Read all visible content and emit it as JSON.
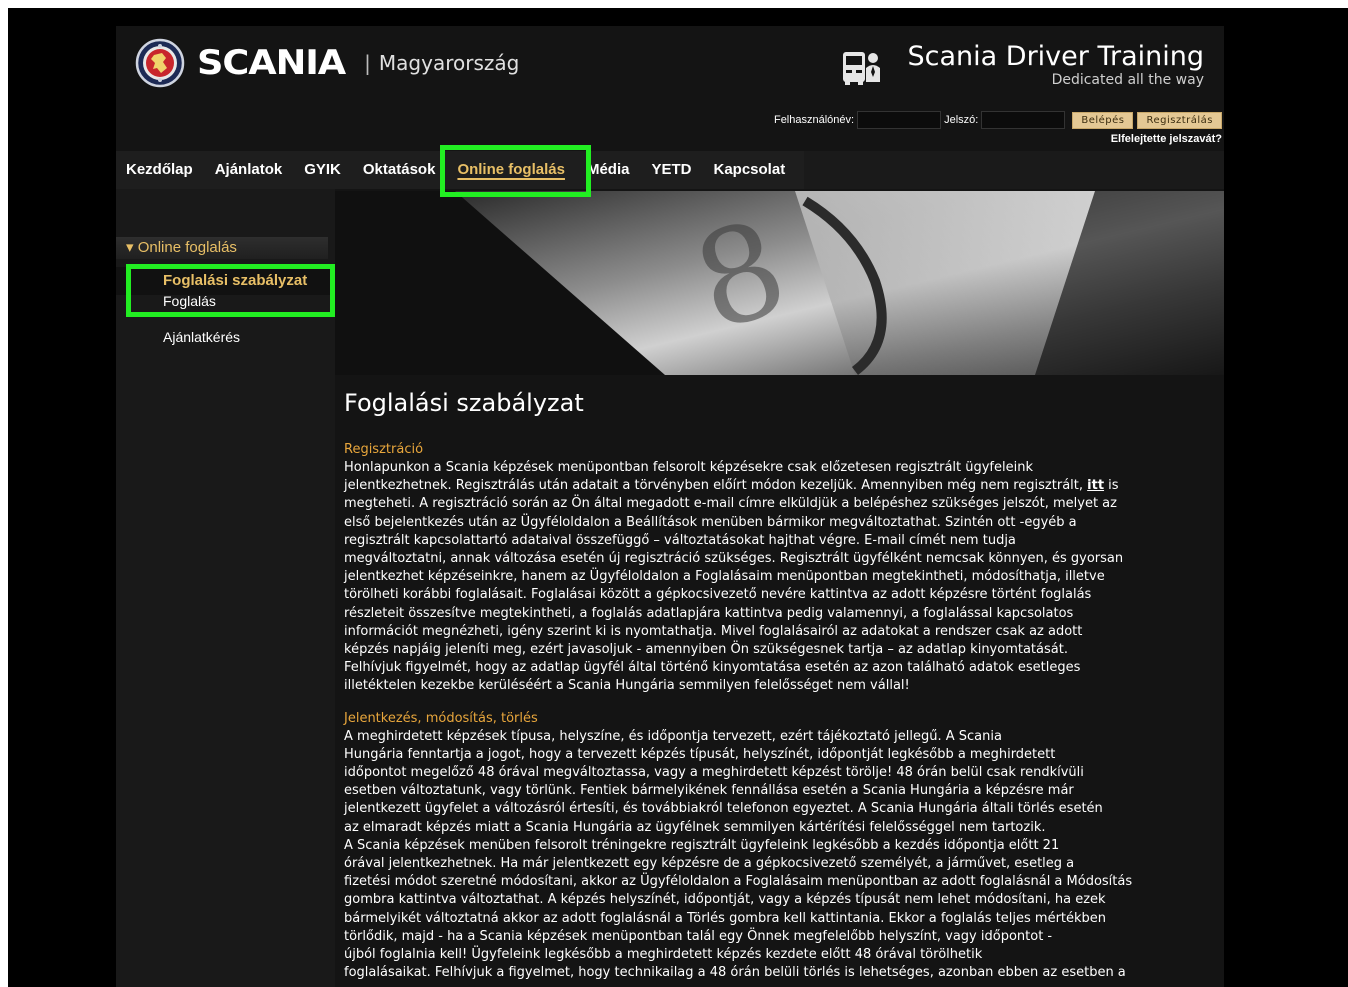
{
  "header": {
    "brand": "SCANIA",
    "country_sep": "|",
    "country": "Magyarország",
    "dt_title": "Scania Driver Training",
    "dt_subtitle": "Dedicated all the way"
  },
  "login": {
    "username_label": "Felhasználónév:",
    "password_label": "Jelszó:",
    "login_button": "Belépés",
    "register_button": "Regisztrálás",
    "forgot_link": "Elfelejtette jelszavát?"
  },
  "nav": {
    "items": [
      "Kezdőlap",
      "Ajánlatok",
      "GYIK",
      "Oktatások",
      "Online foglalás",
      "Média",
      "YETD",
      "Kapcsolat"
    ],
    "active_index": 4
  },
  "sidebar": {
    "heading": "Online foglalás",
    "items": [
      "Foglalási szabályzat",
      "Foglalás",
      "Ajánlatkérés"
    ],
    "active_index": 0
  },
  "content": {
    "title": "Foglalási szabályzat",
    "sections": [
      {
        "heading": "Regisztráció",
        "lines": [
          "Honlapunkon a Scania képzések menüpontban felsorolt képzésekre csak előzetesen regisztrált ügyfeleink",
          "jelentkezhetnek. Regisztrálás után adatait a törvényben előírt módon kezeljük. Amennyiben még nem regisztrált,",
          "megteheti. A regisztráció során az Ön által megadott e-mail címre elküldjük a belépéshez szükséges jelszót, melyet az",
          "első bejelentkezés után az Ügyféloldalon a Beállítások menüben bármikor megváltoztathat. Szintén ott -egyéb a",
          "regisztrált kapcsolattartó adataival összefüggő – változtatásokat hajthat végre. E-mail címét nem tudja",
          "megváltoztatni, annak változása esetén új regisztráció szükséges. Regisztrált ügyfélként nemcsak könnyen, és gyorsan",
          "jelentkezhet képzéseinkre, hanem az Ügyféloldalon a Foglalásaim menüpontban megtekintheti, módosíthatja, illetve",
          "törölheti korábbi foglalásait. Foglalásai között a gépkocsivezető nevére kattintva az adott képzésre történt foglalás",
          "részleteit összesítve megtekintheti, a foglalás adatlapjára kattintva pedig valamennyi, a foglalással kapcsolatos",
          "információt megnézheti, igény szerint ki is nyomtathatja. Mivel foglalásairól az adatokat a rendszer csak az adott",
          "képzés napjáig jeleníti meg, ezért javasoljuk - amennyiben Ön szükségesnek tartja – az adatlap kinyomtatását.",
          "Felhívjuk figyelmét, hogy az adatlap ügyfél által történő kinyomtatása esetén az azon található adatok esetleges",
          "illetéktelen kezekbe kerüléséért a Scania Hungária semmilyen felelősséget nem vállal!"
        ],
        "link_text": "itt",
        "link_suffix": " is"
      },
      {
        "heading": "Jelentkezés, módosítás, törlés",
        "lines": [
          "A meghirdetett képzések típusa, helyszíne, és időpontja tervezett, ezért tájékoztató jellegű. A Scania",
          "Hungária fenntartja a jogot, hogy a tervezett képzés típusát, helyszínét, időpontját legkésőbb a meghirdetett",
          "időpontot megelőző 48 órával megváltoztassa, vagy a meghirdetett képzést törölje! 48 órán belül csak rendkívüli",
          "esetben változtatunk, vagy törlünk. Fentiek bármelyikének fennállása esetén a Scania Hungária a képzésre már",
          "jelentkezett ügyfelet a változásról értesíti, és továbbiakról telefonon egyeztet. A Scania Hungária általi törlés esetén",
          "az elmaradt képzés miatt a Scania Hungária az ügyfélnek semmilyen kártérítési felelősséggel nem tartozik.",
          "A Scania képzések menüben felsorolt tréningekre regisztrált ügyfeleink legkésőbb a kezdés időpontja előtt 21",
          "órával jelentkezhetnek. Ha már jelentkezett egy képzésre de a gépkocsivezető személyét, a járművet, esetleg a",
          "fizetési módot szeretné módosítani, akkor az Ügyféloldalon a Foglalásaim menüpontban az adott foglalásnál a Módosítás",
          "gombra kattintva változtathat. A képzés helyszínét, időpontját, vagy a képzés típusát nem lehet módosítani, ha ezek",
          "bármelyikét változtatná akkor az adott foglalásnál a Törlés gombra kell kattintania. Ekkor a foglalás teljes mértékben",
          "törlődik, majd - ha a Scania képzések menüpontban talál egy Önnek megfelelőbb helyszínt, vagy időpontot -",
          "újból foglalnia kell! Ügyfeleink legkésőbb a meghirdetett képzés kezdete előtt 48 órával törölhetik",
          "foglalásaikat. Felhívjuk a figyelmet, hogy technikailag a 48 órán belüli törlés is lehetséges, azonban ebben az esetben a"
        ]
      }
    ]
  },
  "colors": {
    "accent": "#e8bf66",
    "section_heading": "#e8a63c",
    "highlight_box": "#22ee22",
    "button_bg": "#e4c894"
  }
}
